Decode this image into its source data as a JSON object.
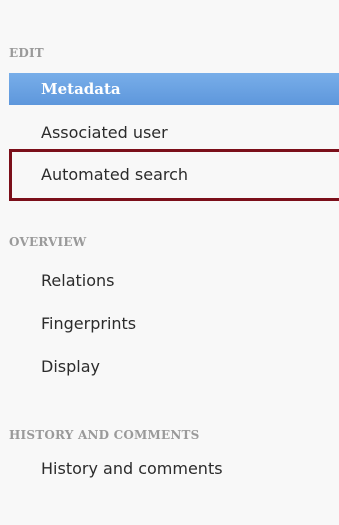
{
  "sections": [
    {
      "heading": "EDIT",
      "items": [
        {
          "label": "Metadata"
        },
        {
          "label": "Associated user"
        },
        {
          "label": "Automated search"
        }
      ]
    },
    {
      "heading": "OVERVIEW",
      "items": [
        {
          "label": "Relations"
        },
        {
          "label": "Fingerprints"
        },
        {
          "label": "Display"
        }
      ]
    },
    {
      "heading": "HISTORY AND COMMENTS",
      "items": [
        {
          "label": "History and comments"
        }
      ]
    }
  ],
  "active_item": "Metadata",
  "highlighted_item": "Automated search",
  "colors": {
    "active_background": "#6aa2e3",
    "highlight_border": "#7b0f1a",
    "heading_text": "#9a9a9a",
    "item_text": "#2b2b2b"
  }
}
